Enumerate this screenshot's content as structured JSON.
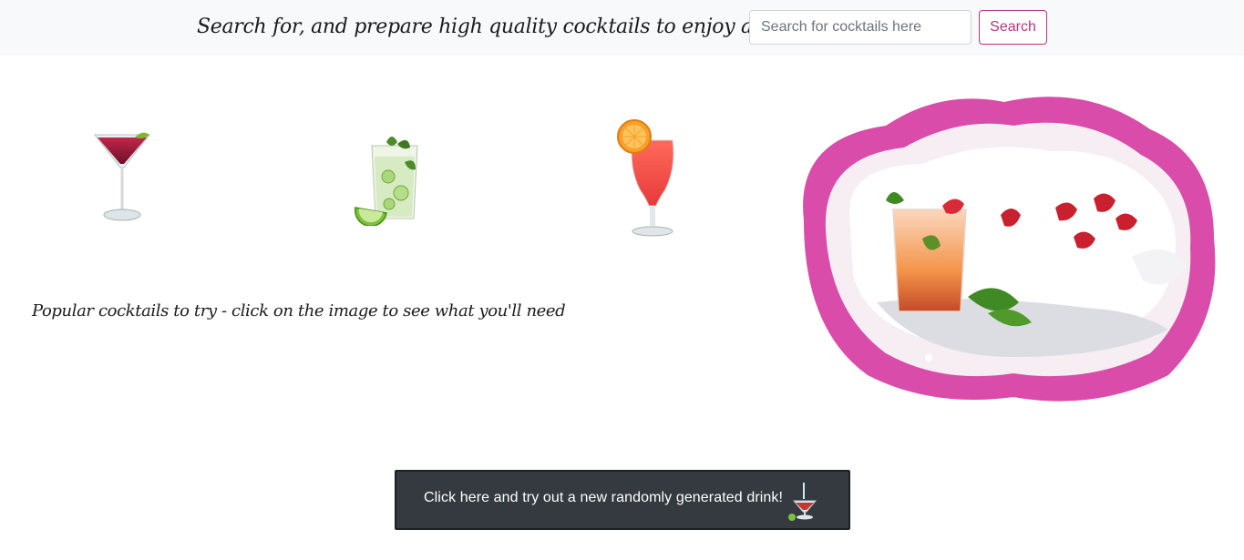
{
  "header": {
    "tagline": "Search for, and prepare high quality cocktails to enjoy at home!",
    "search_placeholder": "Search for cocktails here",
    "search_value": "",
    "search_label": "Search"
  },
  "popular": {
    "caption": "Popular cocktails to try - click on the image to see what you'll need",
    "items": [
      {
        "icon": "cosmopolitan-cocktail-icon"
      },
      {
        "icon": "mojito-cocktail-icon"
      },
      {
        "icon": "hurricane-cocktail-icon"
      }
    ]
  },
  "hero": {
    "icon": "strawberry-cocktail-hero-image"
  },
  "random_drink": {
    "label": "Click here and try out a new randomly generated drink!",
    "icon": "cocktail-glass-icon"
  },
  "colors": {
    "accent": "#b5367f",
    "topbar_bg": "#f8f9fa",
    "button_dark": "#343a40",
    "splash_pink": "#d63fa8"
  }
}
